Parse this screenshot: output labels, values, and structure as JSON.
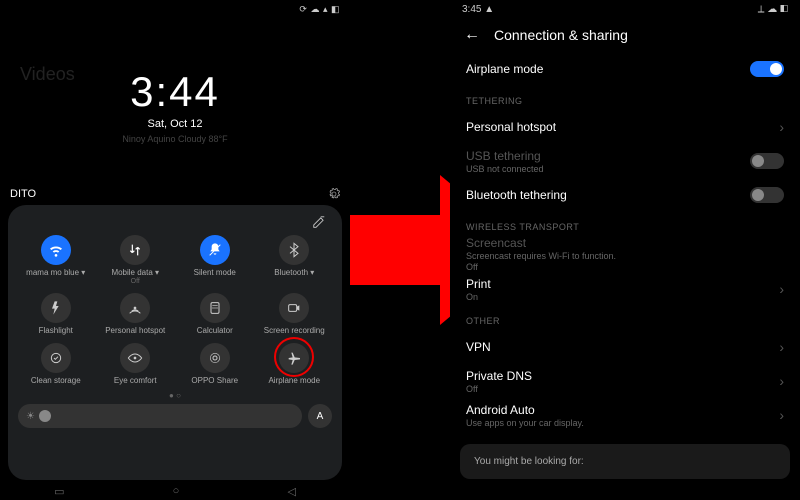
{
  "left": {
    "videos_bg_label": "Videos",
    "status_icons": "⟳ ☁ ▴ ◧",
    "time": "3:44",
    "date": "Sat, Oct 12",
    "weather_line": "Ninoy Aquino Cloudy 88°F",
    "carrier": "DITO",
    "tiles": [
      {
        "label": "mama mo blue",
        "sub": "",
        "on": true,
        "icon": "wifi",
        "drop": true
      },
      {
        "label": "Mobile data",
        "sub": "Off",
        "on": false,
        "icon": "data",
        "drop": true
      },
      {
        "label": "Silent mode",
        "sub": "",
        "on": true,
        "icon": "bell"
      },
      {
        "label": "Bluetooth",
        "sub": "",
        "on": false,
        "icon": "bt",
        "drop": true
      },
      {
        "label": "Flashlight",
        "sub": "",
        "on": false,
        "icon": "flash"
      },
      {
        "label": "Personal hotspot",
        "sub": "",
        "on": false,
        "icon": "hotspot"
      },
      {
        "label": "Calculator",
        "sub": "",
        "on": false,
        "icon": "calc"
      },
      {
        "label": "Screen recording",
        "sub": "",
        "on": false,
        "icon": "rec"
      },
      {
        "label": "Clean storage",
        "sub": "",
        "on": false,
        "icon": "clean"
      },
      {
        "label": "Eye comfort",
        "sub": "",
        "on": false,
        "icon": "eye"
      },
      {
        "label": "OPPO Share",
        "sub": "",
        "on": false,
        "icon": "share"
      },
      {
        "label": "Airplane mode",
        "sub": "",
        "on": false,
        "icon": "plane",
        "ring": true
      }
    ],
    "page_indicator": "● ○",
    "auto_label": "A",
    "nav": {
      "menu": "▭",
      "home": "○",
      "back": "◁"
    }
  },
  "right": {
    "time": "3:45",
    "status_warn": "▲",
    "status_right": "⟂ ☁ ◧",
    "title": "Connection & sharing",
    "airplane": {
      "label": "Airplane mode",
      "on": true
    },
    "categories": [
      {
        "name": "TETHERING",
        "rows": [
          {
            "label": "Personal hotspot",
            "type": "chev"
          },
          {
            "label": "USB tethering",
            "sub": "USB not connected",
            "type": "toggle",
            "on": false,
            "disabled": true
          },
          {
            "label": "Bluetooth tethering",
            "type": "toggle",
            "on": false
          }
        ]
      },
      {
        "name": "WIRELESS TRANSPORT",
        "rows": [
          {
            "label": "Screencast",
            "sub": "Screencast requires Wi-Fi to function.",
            "sub2": "Off",
            "type": "none",
            "disabled": true
          },
          {
            "label": "Print",
            "sub": "On",
            "type": "chev",
            "subcolor": "on"
          }
        ]
      },
      {
        "name": "OTHER",
        "rows": [
          {
            "label": "VPN",
            "type": "chev"
          },
          {
            "label": "Private DNS",
            "sub": "Off",
            "type": "chev"
          },
          {
            "label": "Android Auto",
            "sub": "Use apps on your car display.",
            "type": "chev"
          }
        ]
      }
    ],
    "suggest": "You might be looking for:"
  }
}
